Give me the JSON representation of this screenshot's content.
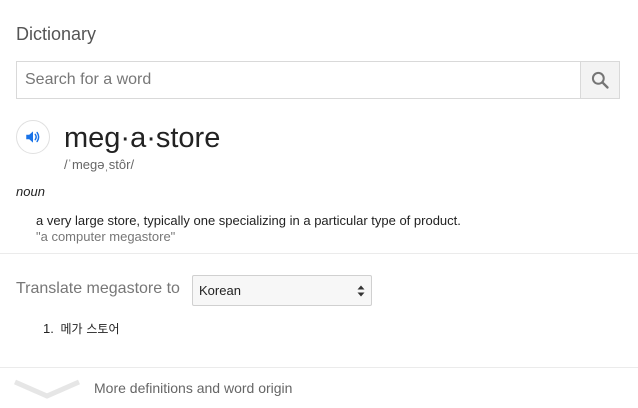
{
  "dictionary": {
    "title": "Dictionary",
    "search": {
      "placeholder": "Search for a word",
      "value": "",
      "button_icon": "search-icon"
    },
    "entry": {
      "audio_icon": "speaker-icon",
      "word": "meg·a·store",
      "pronunciation": "/ˈmeɡəˌstôr/",
      "part_of_speech": "noun",
      "definitions": [
        {
          "text": "a very large store, typically one specializing in a particular type of product.",
          "example": "\"a computer megastore\""
        }
      ]
    },
    "translate": {
      "label": "Translate megastore to",
      "selected_language": "Korean",
      "results": [
        {
          "number": "1.",
          "text": "메가 스토어"
        }
      ]
    },
    "more": {
      "label": "More definitions and word origin",
      "icon": "chevron-down-icon"
    },
    "colors": {
      "accent_blue": "#1a73e8",
      "icon_gray": "#757575",
      "divider": "#ebebeb"
    }
  }
}
